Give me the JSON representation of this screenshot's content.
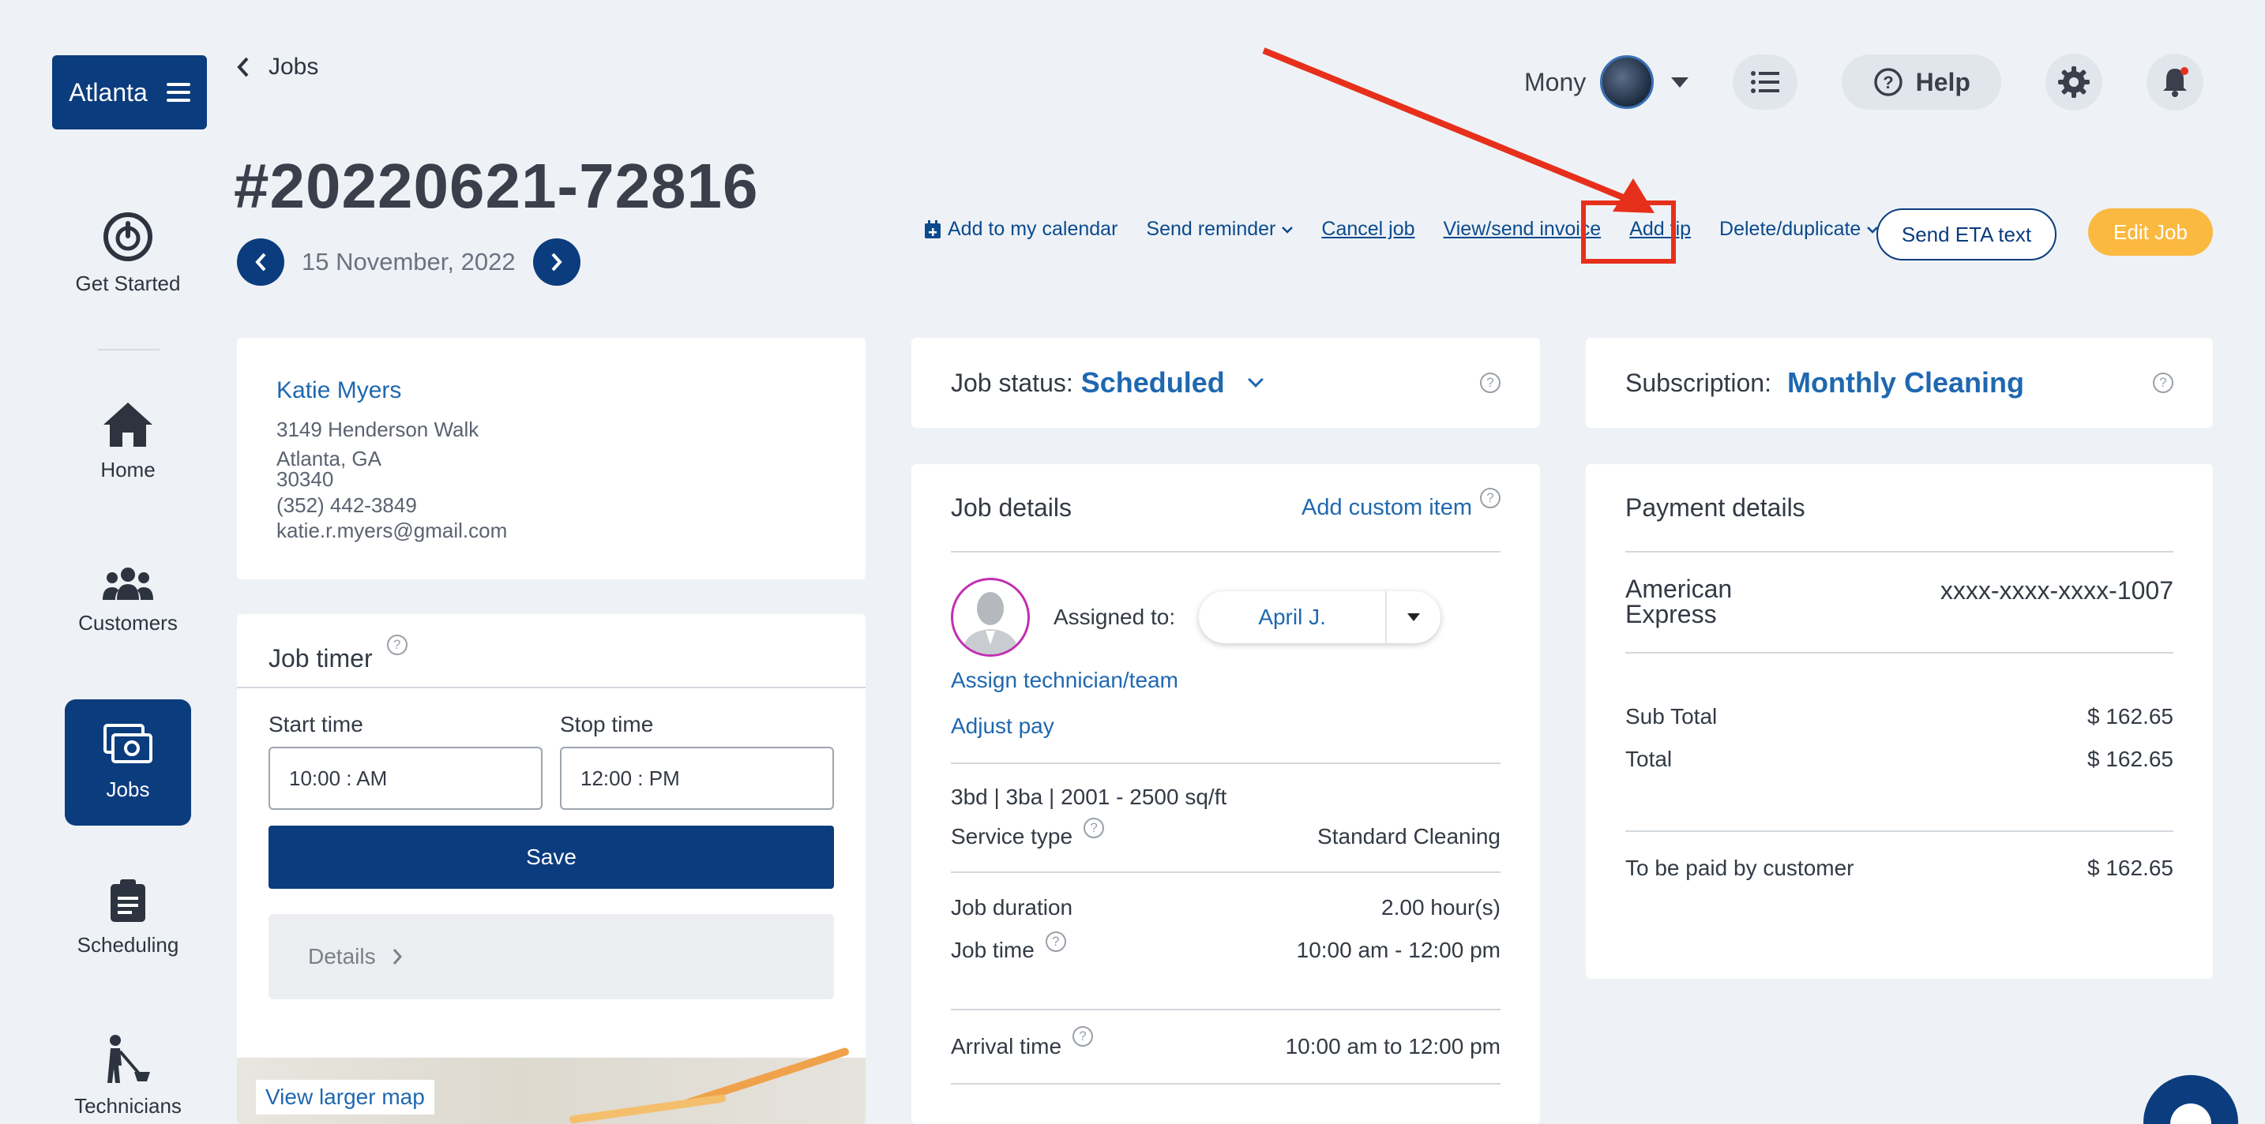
{
  "brand": {
    "label": "Atlanta"
  },
  "sidebar": {
    "items": [
      {
        "label": "Get Started",
        "icon": "power-icon"
      },
      {
        "label": "Home",
        "icon": "home-icon"
      },
      {
        "label": "Customers",
        "icon": "users-icon"
      },
      {
        "label": "Jobs",
        "icon": "jobs-icon",
        "active": true
      },
      {
        "label": "Scheduling",
        "icon": "clipboard-icon"
      },
      {
        "label": "Technicians",
        "icon": "cleaner-icon"
      }
    ]
  },
  "header": {
    "breadcrumb": "Jobs",
    "job_number": "#20220621-72816",
    "date": "15 November, 2022",
    "user_name": "Mony",
    "help_label": "Help"
  },
  "actions": {
    "add_calendar": "Add to my calendar",
    "send_reminder": "Send reminder",
    "cancel_job": "Cancel job",
    "view_invoice": "View/send invoice",
    "add_tip": "Add tip",
    "delete_duplicate": "Delete/duplicate",
    "send_eta": "Send ETA text",
    "edit_job": "Edit Job"
  },
  "customer": {
    "name": "Katie Myers",
    "street": "3149 Henderson Walk",
    "city": "Atlanta, GA",
    "zip": "30340",
    "phone": "(352) 442-3849",
    "email": "katie.r.myers@gmail.com"
  },
  "timer": {
    "title": "Job timer",
    "start_label": "Start time",
    "stop_label": "Stop time",
    "start_value": "10:00 : AM",
    "stop_value": "12:00 : PM",
    "save_label": "Save",
    "details_label": "Details",
    "map_link": "View larger map"
  },
  "status": {
    "label": "Job status:",
    "value": "Scheduled"
  },
  "job_details": {
    "title": "Job details",
    "add_custom": "Add custom item",
    "assigned_label": "Assigned to:",
    "assigned_value": "April J.",
    "assign_link": "Assign technician/team",
    "adjust_link": "Adjust pay",
    "size": "3bd | 3ba | 2001 - 2500 sq/ft",
    "service_type_label": "Service type",
    "service_type_value": "Standard Cleaning",
    "duration_label": "Job duration",
    "duration_value": "2.00 hour(s)",
    "job_time_label": "Job time",
    "job_time_value": "10:00 am - 12:00 pm",
    "arrival_label": "Arrival time",
    "arrival_value": "10:00 am to 12:00 pm"
  },
  "subscription": {
    "label": "Subscription:",
    "value": "Monthly Cleaning"
  },
  "payment": {
    "title": "Payment details",
    "card_brand_line1": "American",
    "card_brand_line2": "Express",
    "card_number": "xxxx-xxxx-xxxx-1007",
    "subtotal_label": "Sub Total",
    "subtotal_value": "$ 162.65",
    "total_label": "Total",
    "total_value": "$ 162.65",
    "to_pay_label": "To be paid by customer",
    "to_pay_value": "$ 162.65"
  },
  "colors": {
    "primary": "#0b3c7e",
    "link": "#1f68b0",
    "accent": "#fbb93f",
    "highlight": "#e6301c",
    "background": "#eef2f6"
  }
}
